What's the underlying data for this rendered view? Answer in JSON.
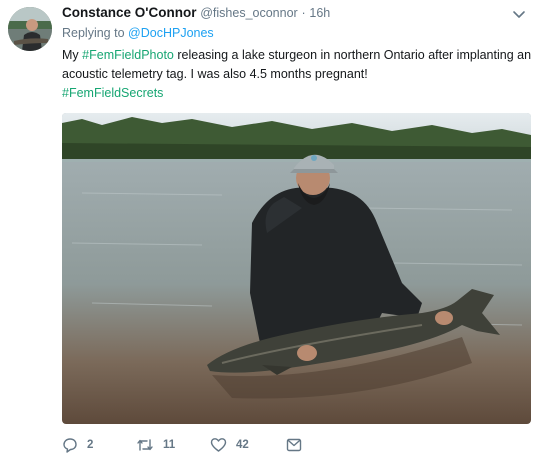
{
  "tweet": {
    "name": "Constance O'Connor",
    "handle": "@fishes_oconnor",
    "separator": "·",
    "time": "16h",
    "reply_prefix": "Replying to",
    "reply_handle": "@DocHPJones",
    "text_prefix": "My",
    "hashtag_1": "#FemFieldPhoto",
    "text_body": "releasing a lake sturgeon in northern Ontario after implanting an acoustic telemetry tag. I was also 4.5 months pregnant!",
    "hashtag_2": "#FemFieldSecrets"
  },
  "actions": {
    "replies": "2",
    "retweets": "11",
    "likes": "42"
  },
  "icons": {
    "reply": "reply-icon",
    "retweet": "retweet-icon",
    "like": "heart-icon",
    "message": "direct-message-icon",
    "more": "chevron-down-icon"
  },
  "colors": {
    "hashtag": "#17a673",
    "link": "#1da1f2",
    "muted": "#657786"
  }
}
